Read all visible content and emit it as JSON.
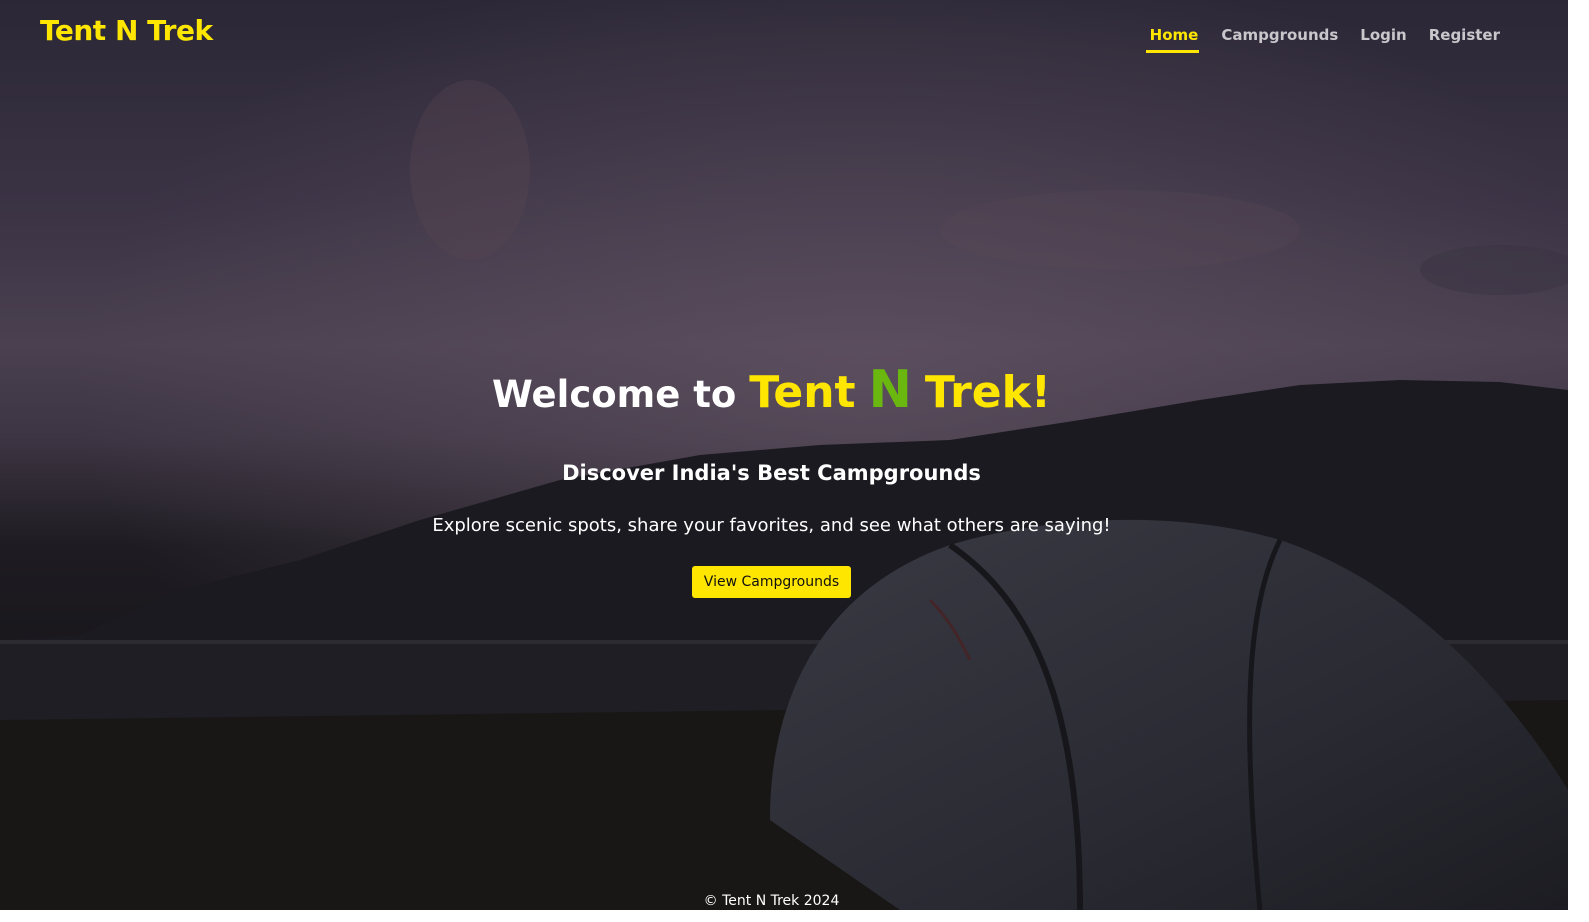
{
  "header": {
    "brand": "Tent N Trek",
    "nav": [
      {
        "label": "Home",
        "active": true
      },
      {
        "label": "Campgrounds",
        "active": false
      },
      {
        "label": "Login",
        "active": false
      },
      {
        "label": "Register",
        "active": false
      }
    ]
  },
  "hero": {
    "welcome_prefix": "Welcome to",
    "brand_tent": "Tent",
    "brand_n": "N",
    "brand_trek": "Trek!",
    "subtitle": "Discover India's Best Campgrounds",
    "description": "Explore scenic spots, share your favorites, and see what others are saying!",
    "cta_label": "View Campgrounds"
  },
  "footer": {
    "text": "© Tent N Trek 2024"
  },
  "colors": {
    "accent": "#ffe600",
    "green": "#6ab80f",
    "text": "#ffffff",
    "nav_inactive": "#c9c6cc"
  }
}
